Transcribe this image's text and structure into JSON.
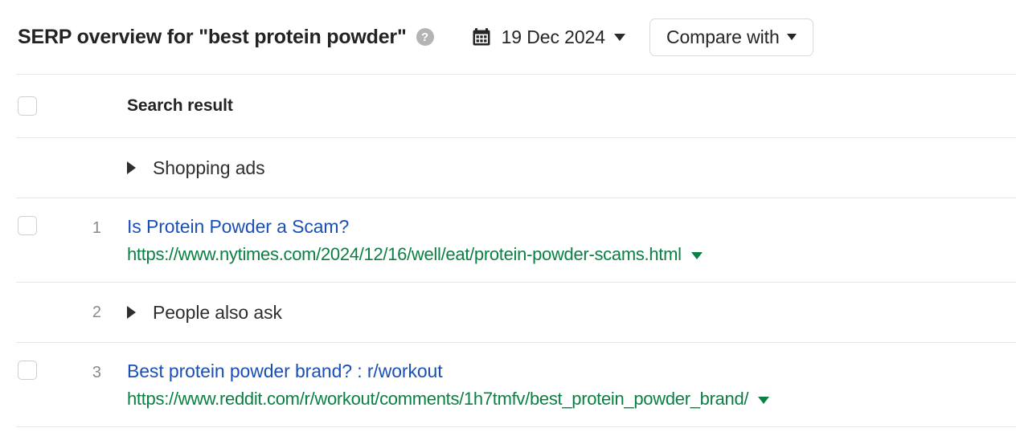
{
  "header": {
    "title": "SERP overview for \"best protein powder\"",
    "help_icon": "question-mark-icon",
    "help_glyph": "?",
    "date": {
      "icon": "calendar-icon",
      "value": "19 Dec 2024"
    },
    "compare_button": {
      "label": "Compare with",
      "icon": "chevron-down-icon"
    }
  },
  "table": {
    "column_header": "Search result",
    "rows": [
      {
        "type": "group",
        "checkbox": false,
        "rank": "",
        "label": "Shopping ads",
        "expander": "triangle-right-icon"
      },
      {
        "type": "result",
        "checkbox": true,
        "rank": "1",
        "title": "Is Protein Powder a Scam?",
        "url": "https://www.nytimes.com/2024/12/16/well/eat/protein-powder-scams.html"
      },
      {
        "type": "group",
        "checkbox": false,
        "rank": "2",
        "label": "People also ask",
        "expander": "triangle-right-icon"
      },
      {
        "type": "result",
        "checkbox": true,
        "rank": "3",
        "title": "Best protein powder brand? : r/workout",
        "url": "https://www.reddit.com/r/workout/comments/1h7tmfv/best_protein_powder_brand/"
      }
    ]
  },
  "colors": {
    "link_blue": "#1a4fb5",
    "url_green": "#0b8043",
    "text_dark": "#232323",
    "rank_gray": "#8a8a8a",
    "divider": "#e6e6e6",
    "border": "#dadada"
  }
}
